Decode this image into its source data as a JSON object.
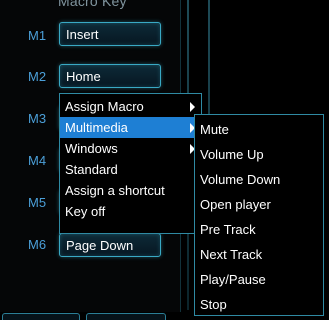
{
  "panel": {
    "title": "Macro Key",
    "rows": [
      {
        "label": "M1",
        "key": "Insert"
      },
      {
        "label": "M2",
        "key": "Home"
      },
      {
        "label": "M3",
        "key": ""
      },
      {
        "label": "M4",
        "key": ""
      },
      {
        "label": "M5",
        "key": ""
      },
      {
        "label": "M6",
        "key": "Page Down"
      }
    ]
  },
  "context_menu": {
    "items": [
      {
        "label": "Assign Macro",
        "has_submenu": true
      },
      {
        "label": "Multimedia",
        "has_submenu": true,
        "selected": true
      },
      {
        "label": "Windows",
        "has_submenu": true
      },
      {
        "label": "Standard",
        "has_submenu": false
      },
      {
        "label": "Assign a shortcut",
        "has_submenu": false
      },
      {
        "label": "Key off",
        "has_submenu": false
      }
    ]
  },
  "submenu": {
    "items": [
      "Mute",
      "Volume Up",
      "Volume Down",
      "Open player",
      "Pre Track",
      "Next Track",
      "Play/Pause",
      "Stop"
    ]
  },
  "colors": {
    "accent": "#39a9c4",
    "selection": "#1e7fd4",
    "row_label": "#4b9fd8"
  }
}
